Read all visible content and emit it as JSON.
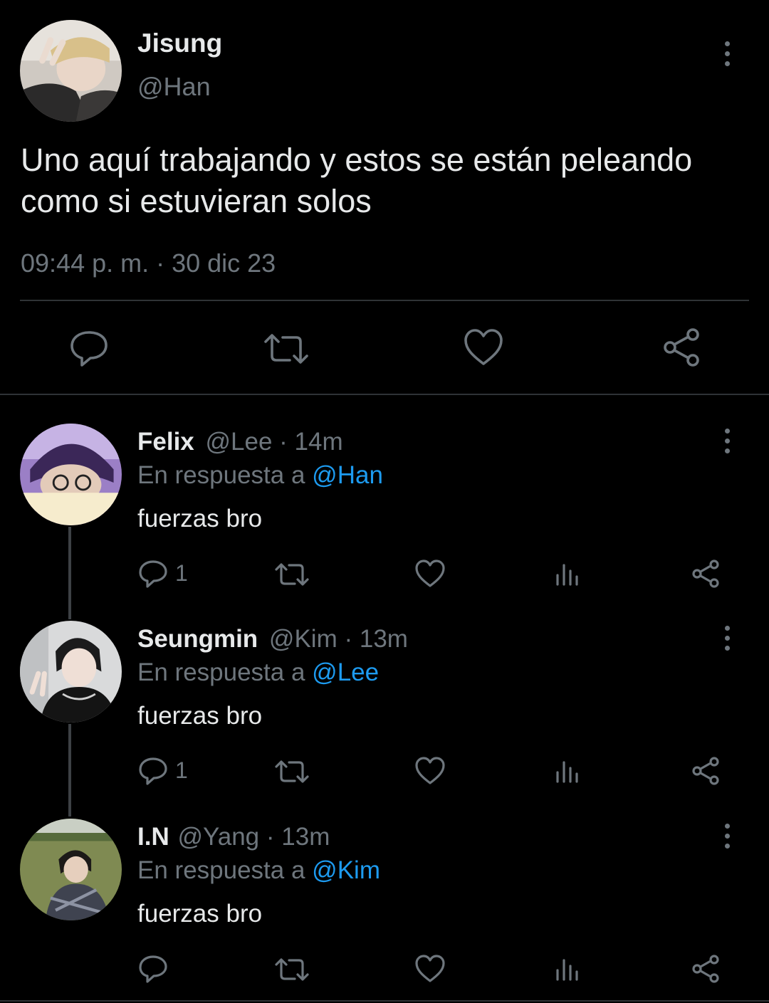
{
  "main_tweet": {
    "display_name": "Jisung",
    "handle": "@Han",
    "text_line1": "Uno aquí trabajando y estos se están peleando",
    "text_line2": "como si estuvieran solos",
    "timestamp": "09:44 p. m. · 30 dic 23",
    "actions": [
      "reply-icon",
      "retweet-icon",
      "like-icon",
      "share-icon"
    ]
  },
  "replies": [
    {
      "display_name": "Felix",
      "handle": "@Lee",
      "time": "· 14m",
      "reply_prefix": "En respuesta a",
      "reply_to": "@Han",
      "text": "fuerzas bro",
      "reply_count": "1"
    },
    {
      "display_name": "Seungmin",
      "handle": "@Kim",
      "time": "· 13m",
      "reply_prefix": "En respuesta a",
      "reply_to": "@Lee",
      "text": "fuerzas bro",
      "reply_count": "1"
    },
    {
      "display_name": "I.N",
      "handle": "@Yang",
      "time": "· 13m",
      "reply_prefix": "En respuesta a",
      "reply_to": "@Kim",
      "text": "fuerzas bro",
      "reply_count": ""
    }
  ],
  "colors": {
    "background": "#000000",
    "text": "#e7e9ea",
    "muted": "#6e767d",
    "link": "#1d9bf0",
    "divider": "#2f3336"
  }
}
